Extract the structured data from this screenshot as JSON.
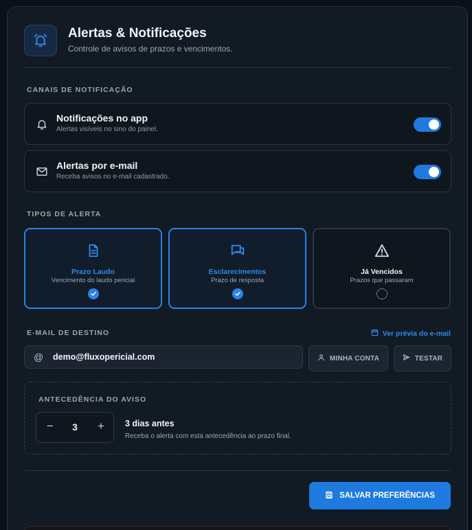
{
  "header": {
    "title": "Alertas & Notificações",
    "subtitle": "Controle de avisos de prazos e vencimentos.",
    "icon": "bell-ringing-icon"
  },
  "channels": {
    "section_label": "CANAIS DE NOTIFICAÇÃO",
    "items": [
      {
        "title": "Notificações no app",
        "subtitle": "Alertas visíveis no sino do painel.",
        "icon": "bell-icon",
        "enabled": true
      },
      {
        "title": "Alertas por e-mail",
        "subtitle": "Receba avisos no e-mail cadastrado.",
        "icon": "mail-icon",
        "enabled": true
      }
    ]
  },
  "alert_types": {
    "section_label": "TIPOS DE ALERTA",
    "items": [
      {
        "title": "Prazo Laudo",
        "subtitle": "Vencimento do laudo pericial",
        "icon": "document-icon",
        "selected": true
      },
      {
        "title": "Esclarecimentos",
        "subtitle": "Prazo de resposta",
        "icon": "chat-icon",
        "selected": true
      },
      {
        "title": "Já Vencidos",
        "subtitle": "Prazos que passaram",
        "icon": "warning-icon",
        "selected": false
      }
    ]
  },
  "email": {
    "section_label": "E-MAIL DE DESTINO",
    "preview_link": "Ver prévia do e-mail",
    "value": "demo@fluxopericial.com",
    "at_symbol": "@",
    "my_account_label": "MINHA CONTA",
    "test_label": "TESTAR"
  },
  "advance": {
    "section_label": "ANTECEDÊNCIA DO AVISO",
    "value": "3",
    "minus": "−",
    "plus": "+",
    "title": "3 dias antes",
    "description": "Receba o alerta com esta antecedência ao prazo final."
  },
  "save_label": "SALVAR PREFERÊNCIAS",
  "colors": {
    "accent": "#1f7ae0",
    "background": "#121a23"
  }
}
